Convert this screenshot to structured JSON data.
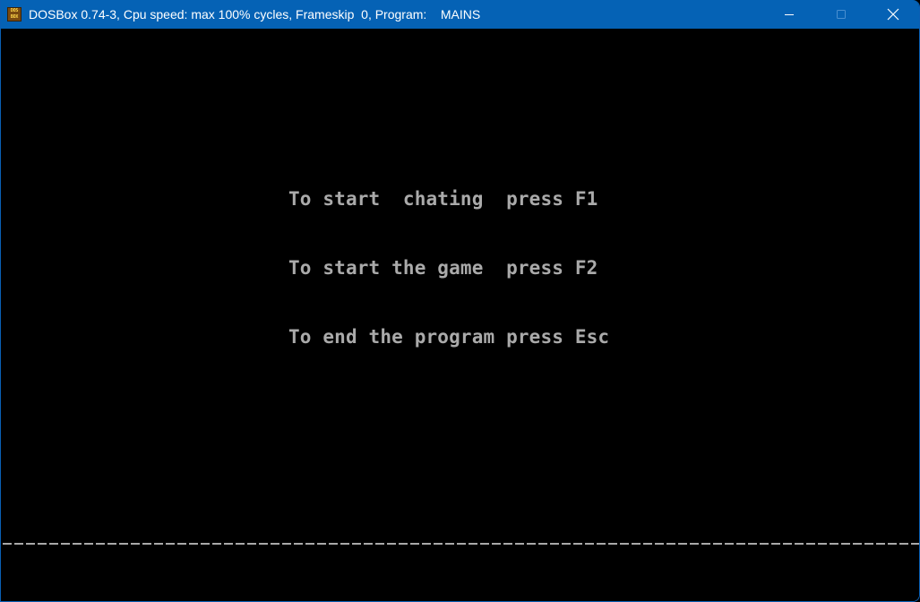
{
  "window": {
    "title": "DOSBox 0.74-3, Cpu speed: max 100% cycles, Frameskip  0, Program:    MAINS",
    "app_icon": {
      "name": "dosbox-icon",
      "top": "DOS",
      "bottom": "BOX"
    },
    "controls": {
      "minimize": "minimize-icon",
      "maximize": "maximize-icon",
      "close": "close-icon"
    },
    "accent_color": "#0562b5"
  },
  "screen": {
    "background": "#000000",
    "text_color": "#aaaaaa",
    "menu_lines": [
      "To start  chating  press F1",
      "To start the game  press F2",
      "To end the program press Esc"
    ],
    "separator": "dashed-line"
  }
}
